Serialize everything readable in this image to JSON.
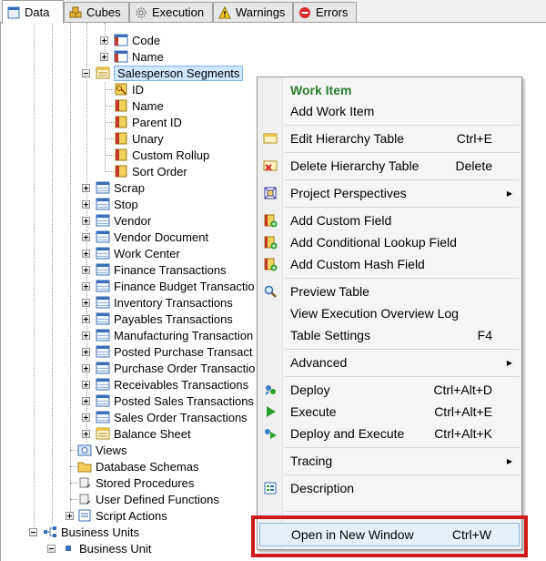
{
  "tabs": [
    {
      "label": "Data",
      "icon": "data-icon",
      "active": true
    },
    {
      "label": "Cubes",
      "icon": "cubes-icon"
    },
    {
      "label": "Execution",
      "icon": "gear-icon"
    },
    {
      "label": "Warnings",
      "icon": "warning-icon"
    },
    {
      "label": "Errors",
      "icon": "error-icon"
    }
  ],
  "tree": {
    "code": "Code",
    "name1": "Name",
    "salesperson_segments": "Salesperson Segments",
    "id": "ID",
    "name2": "Name",
    "parent_id": "Parent ID",
    "unary": "Unary",
    "custom_rollup": "Custom Rollup",
    "sort_order": "Sort Order",
    "tables": [
      "Scrap",
      "Stop",
      "Vendor",
      "Vendor Document",
      "Work Center",
      "Finance Transactions",
      "Finance Budget Transactio",
      "Inventory Transactions",
      "Payables Transactions",
      "Manufacturing Transaction",
      "Posted Purchase Transact",
      "Purchase Order Transactio",
      "Receivables Transactions",
      "Posted Sales Transactions",
      "Sales Order Transactions",
      "Balance Sheet"
    ],
    "views": "Views",
    "database_schemas": "Database Schemas",
    "stored_procedures": "Stored Procedures",
    "user_defined_functions": "User Defined Functions",
    "script_actions": "Script Actions",
    "business_units": "Business Units",
    "business_unit": "Business Unit"
  },
  "menu": {
    "work_item_header": "Work Item",
    "add_work_item": "Add Work Item",
    "edit_hierarchy_table": "Edit Hierarchy Table",
    "edit_hierarchy_table_sc": "Ctrl+E",
    "delete_hierarchy_table": "Delete Hierarchy Table",
    "delete_hierarchy_table_sc": "Delete",
    "project_perspectives": "Project Perspectives",
    "add_custom_field": "Add Custom Field",
    "add_conditional_lookup_field": "Add Conditional Lookup Field",
    "add_custom_hash_field": "Add Custom Hash Field",
    "preview_table": "Preview Table",
    "view_execution_overview_log": "View Execution Overview Log",
    "table_settings": "Table Settings",
    "table_settings_sc": "F4",
    "advanced": "Advanced",
    "deploy": "Deploy",
    "deploy_sc": "Ctrl+Alt+D",
    "execute": "Execute",
    "execute_sc": "Ctrl+Alt+E",
    "deploy_and_execute": "Deploy and Execute",
    "deploy_and_execute_sc": "Ctrl+Alt+K",
    "tracing": "Tracing",
    "description": "Description",
    "open_in_new_window": "Open in New Window",
    "open_in_new_window_sc": "Ctrl+W"
  },
  "colors": {
    "accent_green": "#2a7d2a",
    "highlight_red": "#cc1b1b",
    "selection_blue": "#cde8ff"
  }
}
